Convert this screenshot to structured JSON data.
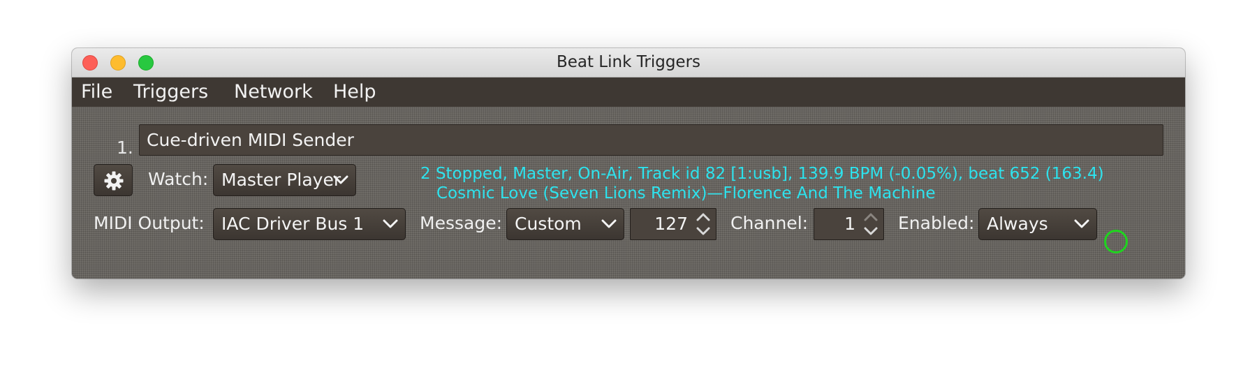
{
  "window": {
    "title": "Beat Link Triggers"
  },
  "menubar": {
    "items": [
      "File",
      "Triggers",
      "Network",
      "Help"
    ]
  },
  "trigger": {
    "index": "1.",
    "comment": "Cue-driven MIDI Sender",
    "gear_icon": "gear-icon",
    "watch_label": "Watch:",
    "watch_value": "Master Player",
    "status_line_1": "2 Stopped, Master, On-Air, Track id 82 [1:usb], 139.9 BPM (-0.05%), beat 652 (163.4)",
    "status_line_2": "Cosmic Love (Seven Lions Remix)—Florence And The Machine",
    "status_color": "#2de3ee",
    "midi_output_label": "MIDI Output:",
    "midi_output_value": "IAC Driver Bus 1",
    "message_label": "Message:",
    "message_value": "Custom",
    "note_value": "127",
    "channel_label": "Channel:",
    "channel_value": "1",
    "enabled_label": "Enabled:",
    "enabled_value": "Always",
    "indicator_color": "#1fd41f"
  }
}
